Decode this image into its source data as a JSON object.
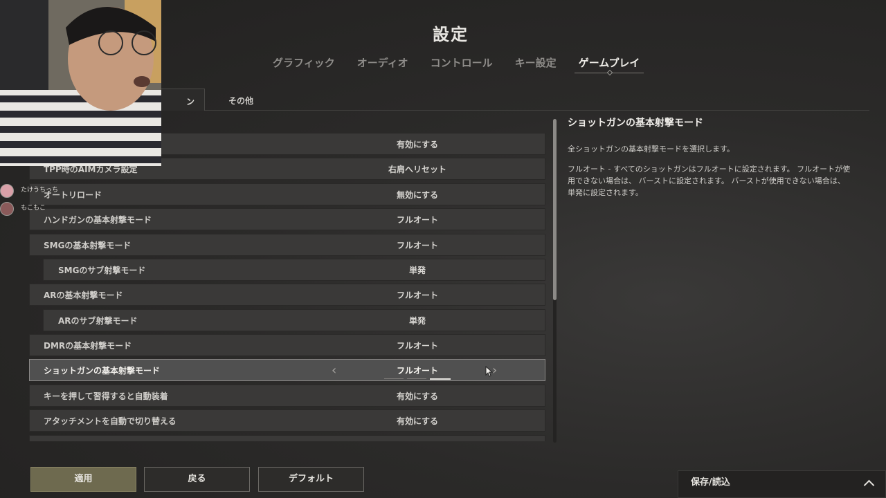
{
  "header": {
    "title": "設定"
  },
  "tabs": [
    {
      "label": "グラフィック"
    },
    {
      "label": "オーディオ"
    },
    {
      "label": "コントロール"
    },
    {
      "label": "キー設定"
    },
    {
      "label": "ゲームプレイ",
      "active": true
    }
  ],
  "subtabs": {
    "active_partial": "ン",
    "other": "その他"
  },
  "settings": [
    {
      "label": "",
      "value": "有効にする"
    },
    {
      "label": "TPP時のAIMカメラ設定",
      "value": "右肩へリセット"
    },
    {
      "label": "オートリロード",
      "value": "無効にする"
    },
    {
      "label": "ハンドガンの基本射撃モード",
      "value": "フルオート"
    },
    {
      "label": "SMGの基本射撃モード",
      "value": "フルオート"
    },
    {
      "label": "SMGのサブ射撃モード",
      "value": "単発",
      "sub": true
    },
    {
      "label": "ARの基本射撃モード",
      "value": "フルオート"
    },
    {
      "label": "ARのサブ射撃モード",
      "value": "単発",
      "sub": true
    },
    {
      "label": "DMRの基本射撃モード",
      "value": "フルオート"
    },
    {
      "label": "ショットガンの基本射撃モード",
      "value": "フルオート",
      "selected": true,
      "option_index": 2,
      "option_count": 3
    },
    {
      "label": "キーを押して習得すると自動装着",
      "value": "有効にする"
    },
    {
      "label": "アタッチメントを自動で切り替える",
      "value": "有効にする"
    }
  ],
  "description": {
    "title": "ショットガンの基本射撃モード",
    "summary": "全ショットガンの基本射撃モードを選択します。",
    "detail": "フルオート - すべてのショットガンはフルオートに設定されます。 フルオートが使用できない場合は、 バーストに設定されます。 バーストが使用できない場合は、 単発に設定されます。"
  },
  "buttons": {
    "apply": "適用",
    "back": "戻る",
    "default": "デフォルト"
  },
  "save_bar": {
    "label": "保存/読込"
  },
  "viewers": [
    {
      "name": "たけうちっち",
      "color": "#d9a0a8"
    },
    {
      "name": "もこもこ",
      "color": "#8a5a5a"
    }
  ],
  "colors": {
    "accent": "#6e6a4f",
    "selected_row": "#505050",
    "row": "#3a3938"
  }
}
